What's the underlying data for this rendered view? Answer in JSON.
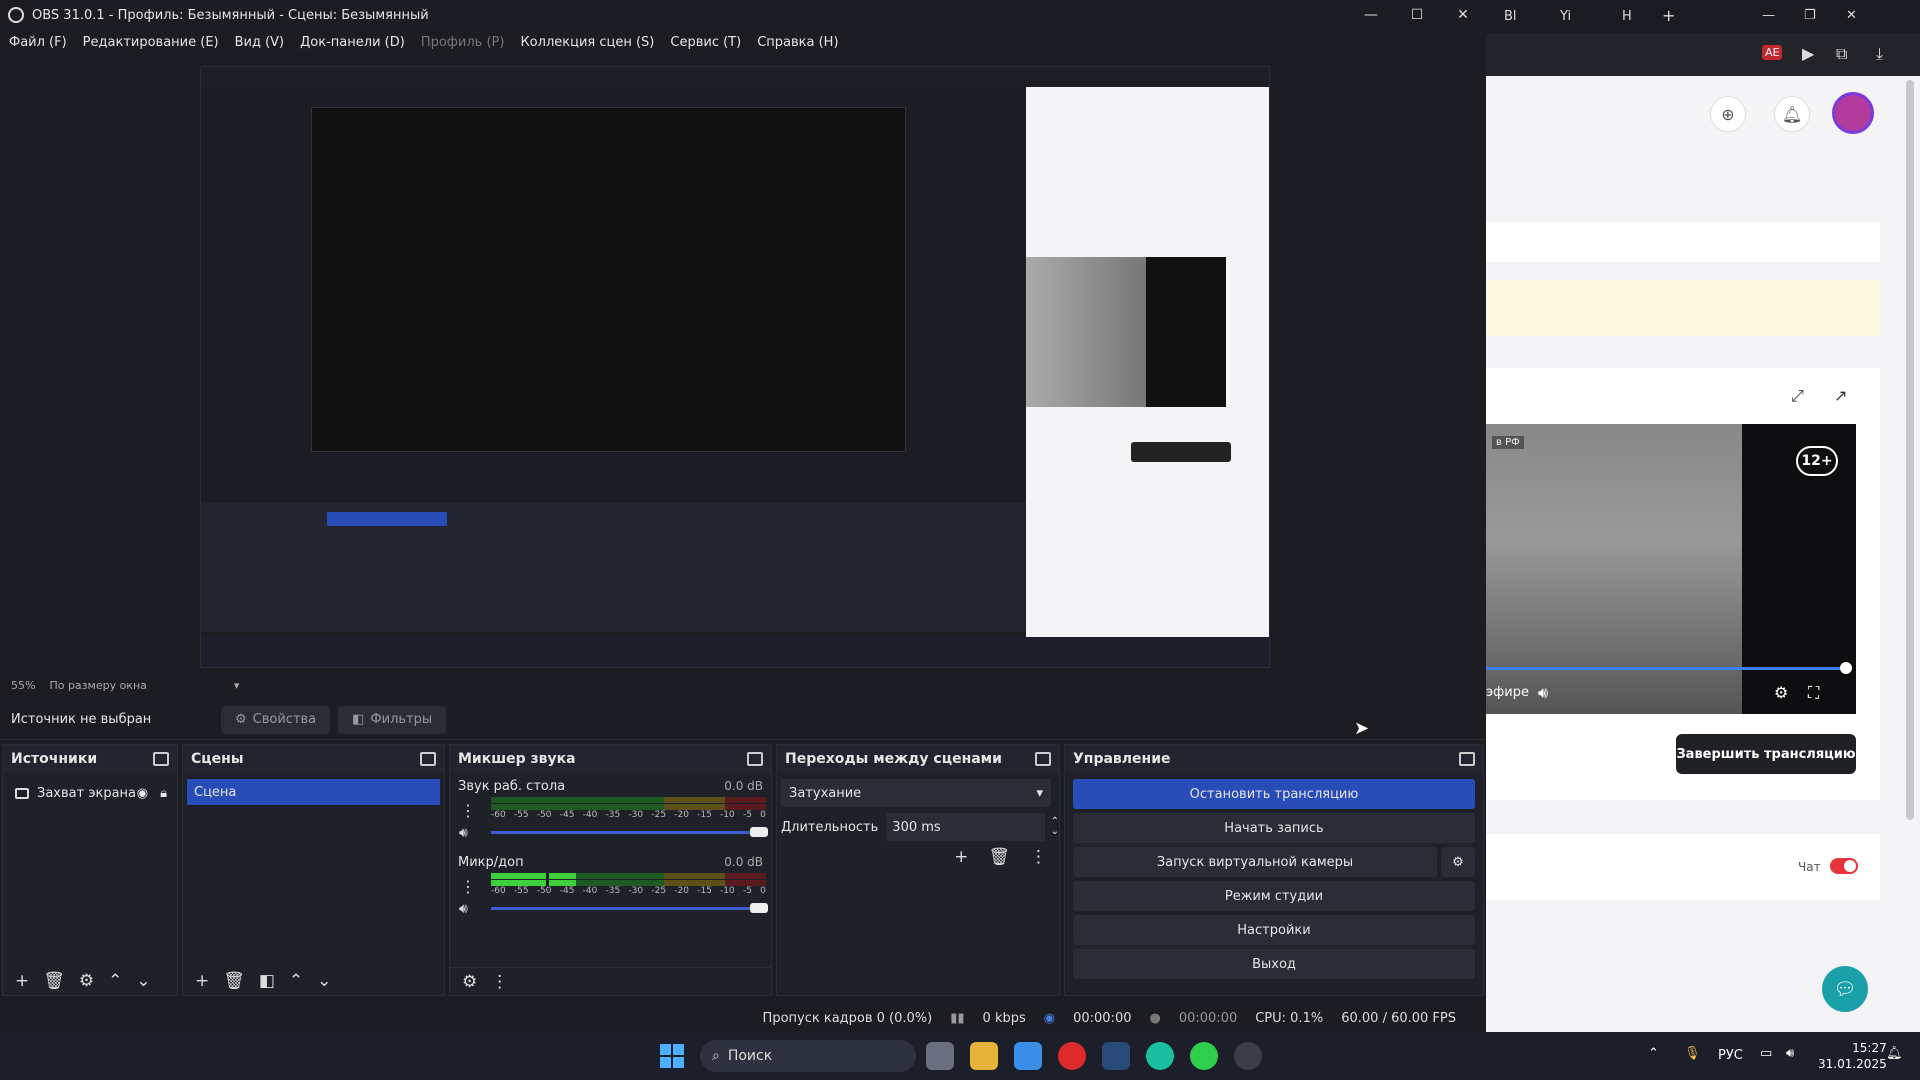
{
  "obs": {
    "title": "OBS 31.0.1 - Профиль: Безымянный - Сцены: Безымянный",
    "menu": [
      "Файл (F)",
      "Редактирование (E)",
      "Вид (V)",
      "Док-панели (D)",
      "Профиль (P)",
      "Коллекция сцен (S)",
      "Сервис (T)",
      "Справка (H)"
    ],
    "zoom": {
      "percent": "55%",
      "mode": "По размеру окна"
    },
    "context": {
      "no_source": "Источник не выбран",
      "properties": "Свойства",
      "filters": "Фильтры"
    },
    "sources": {
      "title": "Источники",
      "items": [
        {
          "label": "Захват экрана"
        }
      ]
    },
    "scenes": {
      "title": "Сцены",
      "items": [
        {
          "label": "Сцена"
        }
      ]
    },
    "mixer": {
      "title": "Микшер звука",
      "ticks": [
        "-60",
        "-55",
        "-50",
        "-45",
        "-40",
        "-35",
        "-30",
        "-25",
        "-20",
        "-15",
        "-10",
        "-5",
        "0"
      ],
      "channels": [
        {
          "name": "Звук раб. стола",
          "db": "0.0 dB",
          "level": 0.0,
          "volume": 1.0
        },
        {
          "name": "Микр/доп",
          "db": "0.0 dB",
          "level": 0.34,
          "volume": 1.0
        }
      ]
    },
    "transitions": {
      "title": "Переходы между сценами",
      "type": "Затухание",
      "duration_label": "Длительность",
      "duration_value": "300 ms"
    },
    "controls": {
      "title": "Управление",
      "stop_stream": "Остановить трансляцию",
      "start_recording": "Начать запись",
      "virtual_camera": "Запуск виртуальной камеры",
      "studio_mode": "Режим студии",
      "settings": "Настройки",
      "exit": "Выход"
    },
    "status": {
      "dropped": "Пропуск кадров 0 (0.0%)",
      "bitrate": "0 kbps",
      "stream_time": "00:00:00",
      "rec_time": "00:00:00",
      "cpu": "CPU: 0.1%",
      "fps": "60.00 / 60.00 FPS"
    }
  },
  "browser": {
    "tabs": [
      "Bl",
      "Yi",
      "H"
    ],
    "age_badge": "12+",
    "live_label": "эфире",
    "end_stream": "Завершить трансляцию",
    "chat_label": "Чат",
    "rf_tag": "в РФ",
    "ext_badge": "AE"
  },
  "taskbar": {
    "search_placeholder": "Поиск",
    "lang": "РУС",
    "time": "15:27",
    "date": "31.01.2025"
  },
  "colors": {
    "accent": "#284cb8",
    "obs_bg": "#1b1d23",
    "toggle_red": "#e8323c"
  }
}
